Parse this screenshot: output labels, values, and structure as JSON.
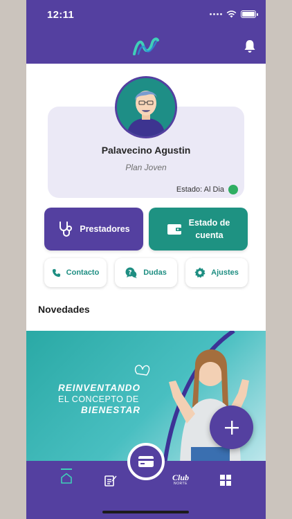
{
  "status_bar": {
    "time": "12:11"
  },
  "header": {
    "logo": "app-logo-icon",
    "bell": "bell-icon"
  },
  "profile": {
    "name": "Palavecino Agustin",
    "plan": "Plan Joven",
    "status_label": "Estado: Al Dia",
    "status_color": "#2fae62"
  },
  "actions": {
    "prestadores": "Prestadores",
    "estado_line1": "Estado de",
    "estado_line2": "cuenta",
    "contacto": "Contacto",
    "dudas": "Dudas",
    "ajustes": "Ajustes"
  },
  "news": {
    "title": "Novedades",
    "banner_line1": "REINVENTANDO",
    "banner_line2": "EL CONCEPTO DE",
    "banner_line3": "BIENESTAR"
  },
  "bottom_nav": {
    "club_line1": "Club",
    "club_line2": "NORTE"
  },
  "colors": {
    "primary": "#5440a0",
    "teal": "#1e9282",
    "accent": "#3fd0b8"
  }
}
